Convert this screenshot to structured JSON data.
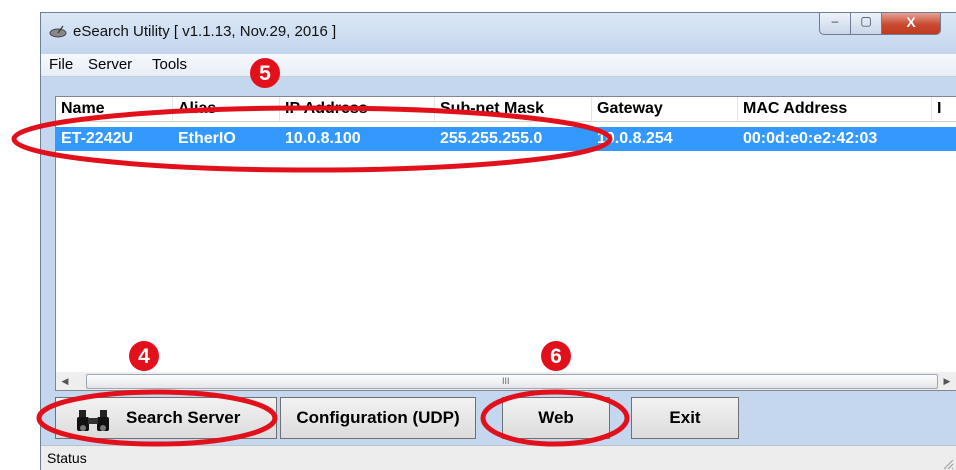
{
  "window": {
    "title": "eSearch Utility [ v1.1.13, Nov.29, 2016 ]",
    "min_glyph": "–",
    "max_glyph": "▢",
    "close_glyph": "X"
  },
  "menu": {
    "items": [
      "File",
      "Server",
      "Tools"
    ]
  },
  "table": {
    "columns": [
      "Name",
      "Alias",
      "IP Address",
      "Sub-net Mask",
      "Gateway",
      "MAC Address",
      "I"
    ],
    "rows": [
      {
        "name": "ET-2242U",
        "alias": "EtherIO",
        "ip": "10.0.8.100",
        "mask": "255.255.255.0",
        "gateway": "10.0.8.254",
        "mac": "00:0d:e0:e2:42:03",
        "selected": true
      }
    ]
  },
  "scrollbar": {
    "left_arrow": "◀",
    "right_arrow": "▶",
    "grip": "III"
  },
  "buttons": {
    "search": "Search Server",
    "config": "Configuration (UDP)",
    "web": "Web",
    "exit": "Exit"
  },
  "status": {
    "text": "Status"
  },
  "annotations": {
    "step_search": "4",
    "step_select": "5",
    "step_web": "6",
    "color": "#e2101a"
  },
  "icons": {
    "app": "satellite-dish-icon",
    "search": "binoculars-icon"
  }
}
